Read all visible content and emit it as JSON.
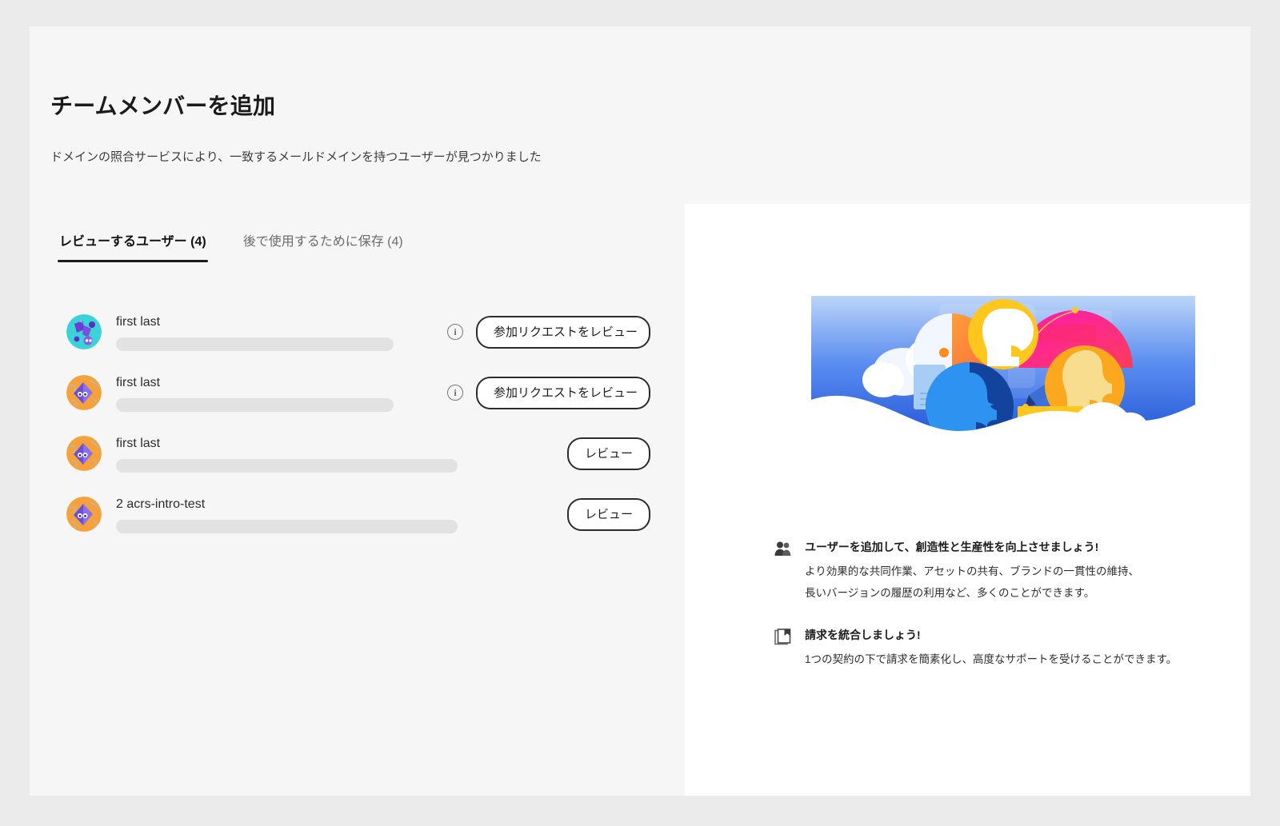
{
  "page": {
    "title": "チームメンバーを追加",
    "subtitle": "ドメインの照合サービスにより、一致するメールドメインを持つユーザーが見つかりました"
  },
  "tabs": [
    {
      "label": "レビューするユーザー (4)",
      "active": true
    },
    {
      "label": "後で使用するために保存 (4)",
      "active": false
    }
  ],
  "users": [
    {
      "name": "first last",
      "email_redacted": true,
      "info_icon": "info-icon",
      "action_label": "参加リクエストをレビュー",
      "avatar": "avatar-teal-abstract"
    },
    {
      "name": "first last",
      "email_redacted": true,
      "info_icon": "info-icon",
      "action_label": "参加リクエストをレビュー",
      "avatar": "avatar-orange-bird"
    },
    {
      "name": "first last",
      "email_redacted": true,
      "info_icon": null,
      "action_label": "レビュー",
      "avatar": "avatar-orange-bird"
    },
    {
      "name": "2 acrs-intro-test",
      "email_redacted": true,
      "info_icon": null,
      "action_label": "レビュー",
      "avatar": "avatar-orange-bird"
    }
  ],
  "promo": {
    "illustration_name": "collaboration-illustration",
    "benefits": [
      {
        "icon": "users-icon",
        "title": "ユーザーを追加して、創造性と生産性を向上させましょう!",
        "lines": [
          "より効果的な共同作業、アセットの共有、ブランドの一貫性の維持、",
          "長いバージョンの履歴の利用など、多くのことができます。"
        ]
      },
      {
        "icon": "billing-book-icon",
        "title": "請求を統合しましょう!",
        "lines": [
          "1つの契約の下で請求を簡素化し、高度なサポートを受けることができます。"
        ]
      }
    ]
  },
  "colors": {
    "page_background": "#ebebeb",
    "card_background": "#f6f6f6",
    "panel_background": "#ffffff",
    "text_primary": "#1b1b1b",
    "text_muted": "#6b6b6b",
    "redaction_bar": "#e2e2e2",
    "button_border": "#2c2c2c"
  }
}
